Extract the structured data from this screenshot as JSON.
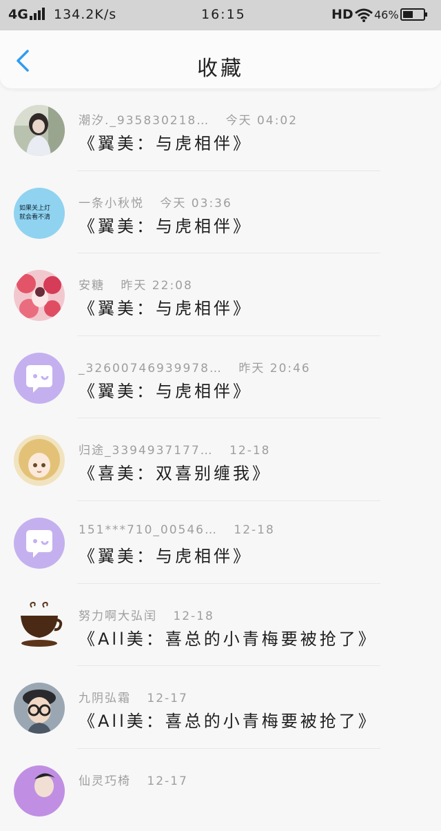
{
  "status_bar": {
    "network": "4G",
    "speed": "134.2K/s",
    "time": "16:15",
    "hd": "HD",
    "battery": "46%"
  },
  "header": {
    "title": "收藏",
    "back_icon": "chevron-left-icon",
    "accent_color": "#2f9cf0"
  },
  "items": [
    {
      "name": "潮汐._935830218…",
      "time": "今天 04:02",
      "message": "《翼美：与虎相伴》",
      "avatar": "photo-girl"
    },
    {
      "name": "一条小秋悦",
      "time": "今天 03:36",
      "message": "《翼美：与虎相伴》",
      "avatar": "blue-text-badge"
    },
    {
      "name": "安糖",
      "time": "昨天 22:08",
      "message": "《翼美：与虎相伴》",
      "avatar": "pink-flower"
    },
    {
      "name": "_3260074693997​8…",
      "time": "昨天 20:46",
      "message": "《翼美：与虎相伴》",
      "avatar": "default-chat"
    },
    {
      "name": "归途_3394937177…",
      "time": "12-18",
      "message": "《喜美：双喜别缠我》",
      "avatar": "anime-blonde"
    },
    {
      "name": "151***710_00546…",
      "time": "12-18",
      "message": "《翼美：与虎相伴》",
      "avatar": "default-chat"
    },
    {
      "name": "努力啊大弘闰",
      "time": "12-18",
      "message": "《All美：喜总的小青梅要被抢了》",
      "avatar": "coffee-cup"
    },
    {
      "name": "九阴弘霜",
      "time": "12-17",
      "message": "《All美：喜总的小青梅要被抢了》",
      "avatar": "boy-glasses"
    },
    {
      "name": "仙灵巧椅",
      "time": "12-17",
      "message": "",
      "avatar": "purple-partial"
    }
  ],
  "avatar_text": {
    "blue_badge_line1": "如果关上灯",
    "blue_badge_line2": "就会看不清"
  }
}
